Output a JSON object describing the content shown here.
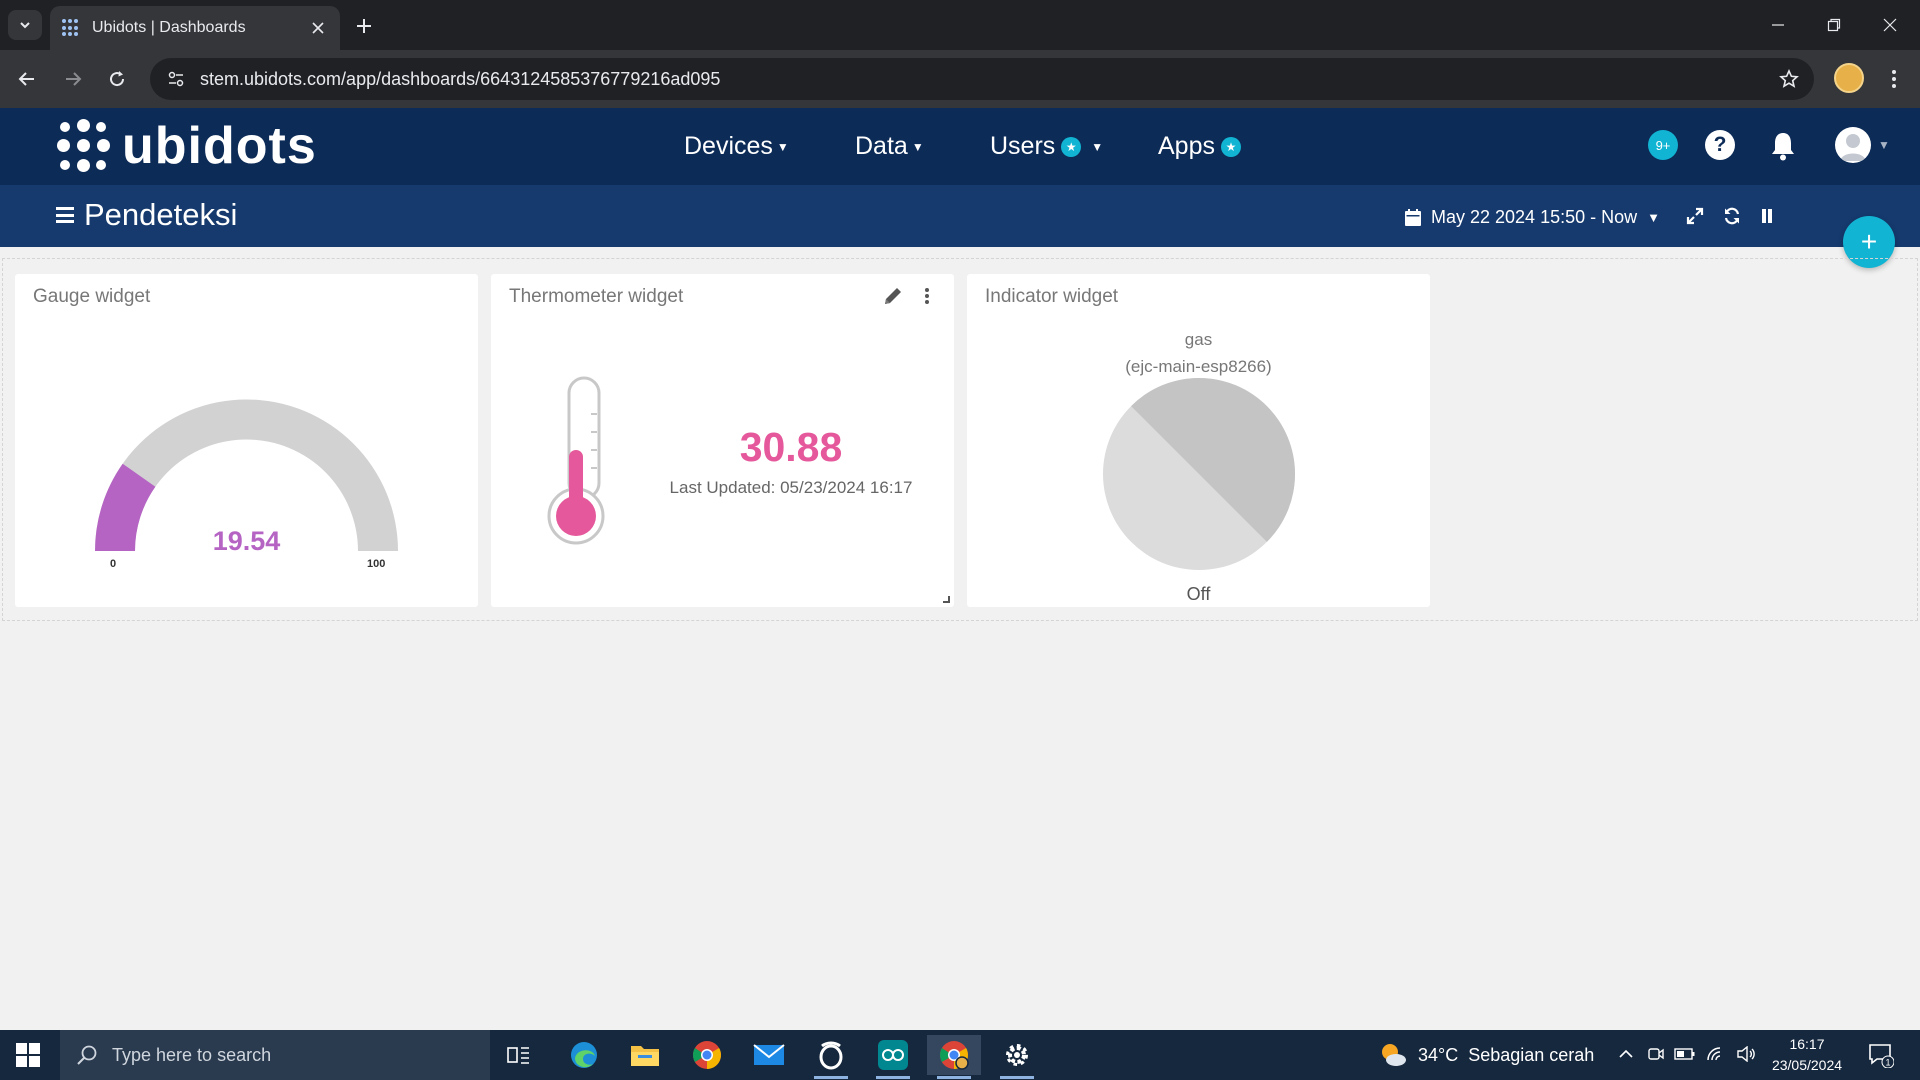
{
  "browser": {
    "tab_title": "Ubidots | Dashboards",
    "url": "stem.ubidots.com/app/dashboards/6643124585376779216ad095",
    "new_tab": "+"
  },
  "header": {
    "logo_text": "ubidots",
    "nav": [
      {
        "label": "Devices",
        "badge": false
      },
      {
        "label": "Data",
        "badge": false
      },
      {
        "label": "Users",
        "badge": true
      },
      {
        "label": "Apps",
        "badge": true
      }
    ],
    "badge_star": "★",
    "notification_count": "9+",
    "help": "?"
  },
  "subheader": {
    "title": "Pendeteksi",
    "date_range": "May 22 2024 15:50 - Now"
  },
  "fab_label": "+",
  "widgets": {
    "gauge": {
      "title": "Gauge widget",
      "value": "19.54",
      "numeric_value": 19.54,
      "min": "0",
      "max": "100",
      "color": "#b564c4"
    },
    "thermometer": {
      "title": "Thermometer widget",
      "value": "30.88",
      "last_updated": "Last Updated: 05/23/2024 16:17",
      "color": "#e5589b"
    },
    "indicator": {
      "title": "Indicator widget",
      "variable": "gas",
      "device": "(ejc-main-esp8266)",
      "state": "Off"
    }
  },
  "taskbar": {
    "search_placeholder": "Type here to search",
    "apps": [
      "task-view",
      "edge",
      "file-explorer",
      "chrome",
      "mail",
      "opera",
      "arduino",
      "chrome-profile",
      "settings"
    ],
    "weather_temp": "34°C",
    "weather_text": "Sebagian cerah",
    "time": "16:17",
    "date": "23/05/2024",
    "notifications": "1"
  },
  "colors": {
    "header_bg": "#0c2b57",
    "subheader_bg": "#163a6e",
    "accent": "#12b4d3"
  }
}
